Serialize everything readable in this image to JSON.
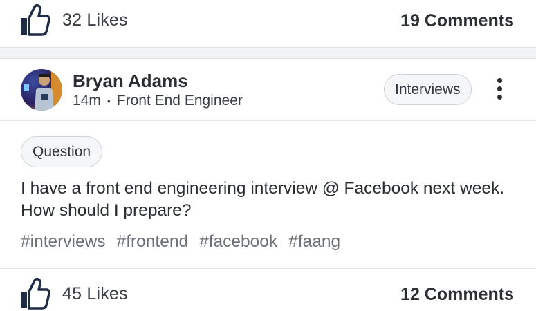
{
  "posts": [
    {
      "likes_label": "32 Likes",
      "comments_label": "19 Comments"
    },
    {
      "author": "Bryan Adams",
      "time": "14m",
      "separator": "•",
      "role": "Front End Engineer",
      "category": "Interviews",
      "type": "Question",
      "text": "I have a front end engineering interview @ Facebook next week. How should I prepare?",
      "tags": [
        "#interviews",
        "#frontend",
        "#facebook",
        "#faang"
      ],
      "likes_label": "45 Likes",
      "comments_label": "12 Comments"
    }
  ],
  "colors": {
    "icon": "#1f2a44",
    "accent_border": "#cfd4da",
    "tag_text": "#6b7178"
  },
  "icons": {
    "like": "thumbs-up-icon",
    "more": "vertical-dots-icon"
  }
}
